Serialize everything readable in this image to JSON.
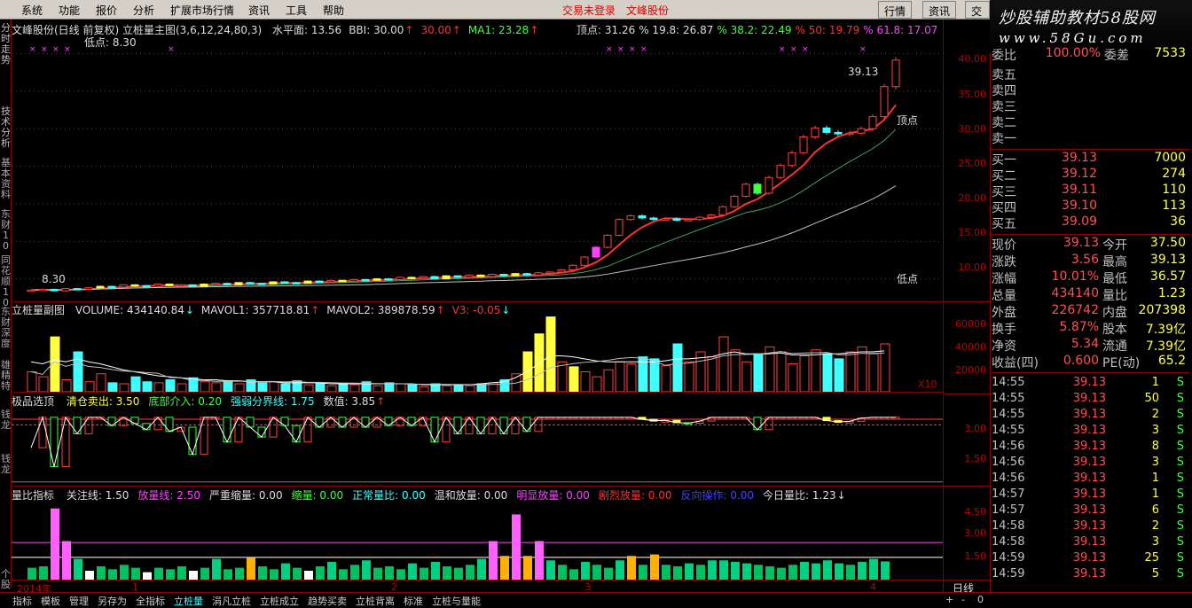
{
  "menu": [
    "系统",
    "功能",
    "报价",
    "分析",
    "扩展市场行情",
    "资讯",
    "工具",
    "帮助"
  ],
  "status": {
    "login": "交易未登录",
    "stock": "文峰股份"
  },
  "toolbar": [
    "行情",
    "资讯",
    "交"
  ],
  "watermark": {
    "line1": "炒股辅助教材58股网",
    "line2": "www.58Gu.com"
  },
  "leftnav": [
    "分时走势",
    "技术分析",
    "基本资料",
    "东财10",
    "同花顺10",
    "东财深度",
    "雄精特",
    "钱龙",
    "钱龙",
    "个股"
  ],
  "main_panel": {
    "header": "文峰股份(日线 前复权) 立桩量主图(3,6,12,24,80,3)",
    "items": [
      [
        "水平面: 13.56",
        "#ddd"
      ],
      [
        "BBI: 30.00",
        "#ddd"
      ],
      [
        "↑",
        "#ff3030"
      ],
      [
        "30.00",
        "#ff3030"
      ],
      [
        "↑",
        "#ff3030"
      ],
      [
        "MA1: 23.28",
        "#40ff40"
      ],
      [
        "↑",
        "#ff3030"
      ]
    ],
    "top_items": [
      [
        "顶点: 31.26",
        "#ddd"
      ],
      [
        "% 19.8: 26.87",
        "#ddd"
      ],
      [
        "% 38.2: 22.49",
        "#40ff40"
      ],
      [
        "% 50: 19.79",
        "#ff3030"
      ],
      [
        "% 61.8: 17.07",
        "#ff40ff"
      ]
    ],
    "lowline": "低点: 8.30",
    "topline": "顶点",
    "bottomlabel": "低点",
    "marker_top": "39.13",
    "marker_low": "8.30",
    "scale": [
      "40.00",
      "35.00",
      "30.00",
      "25.00",
      "20.00",
      "15.00",
      "10.00"
    ]
  },
  "vol_panel": {
    "title": "立桩量副图",
    "items": [
      [
        "VOLUME: 434140.84",
        "#ddd"
      ],
      [
        "↓",
        "#40ffff"
      ],
      [
        "MAVOL1: 357718.81",
        "#ddd"
      ],
      [
        "↑",
        "#ff3030"
      ],
      [
        "MAVOL2: 389878.59",
        "#ddd"
      ],
      [
        "↑",
        "#ff3030"
      ],
      [
        "V3: -0.05",
        "#ff3030"
      ],
      [
        "↓",
        "#40ffff"
      ]
    ],
    "scale": [
      "60000",
      "40000",
      "20000"
    ],
    "unit": "X10"
  },
  "sel_panel": {
    "title": "极品选顶",
    "items": [
      [
        "清仓卖出: 3.50",
        "#ffff40"
      ],
      [
        "底部介入: 0.20",
        "#40ff40"
      ],
      [
        "强弱分界线: 1.75",
        "#40ffff"
      ],
      [
        "数值: 3.85",
        "#ddd"
      ],
      [
        "↑",
        "#ff3030"
      ]
    ],
    "scale": [
      "3.00",
      "1.50"
    ]
  },
  "ratio_panel": {
    "title": "量比指标",
    "items": [
      [
        "关注线: 1.50",
        "#ddd"
      ],
      [
        "放量线: 2.50",
        "#ff40ff"
      ],
      [
        "严重缩量: 0.00",
        "#ddd"
      ],
      [
        "缩量: 0.00",
        "#40ff40"
      ],
      [
        "正常量比: 0.00",
        "#40ffff"
      ],
      [
        "温和放量: 0.00",
        "#ddd"
      ],
      [
        "明显放量: 0.00",
        "#ff40ff"
      ],
      [
        "剧烈放量: 0.00",
        "#ff3030"
      ],
      [
        "反向操作: 0.00",
        "#4040ff"
      ],
      [
        "今日量比: 1.23",
        "#ddd"
      ],
      [
        "↓",
        "#ddd"
      ]
    ],
    "scale": [
      "4.50",
      "3.00",
      "1.50"
    ]
  },
  "dates": [
    "2014年",
    "1",
    "2",
    "3",
    "4"
  ],
  "period": "日线",
  "bottom_tabs": [
    "指标",
    "模板",
    "管理",
    "另存为",
    "全指标",
    "立桩量",
    "涓凡立桩",
    "立桩成立",
    "趋势买卖",
    "立桩背离",
    "标准",
    "立桩与量能"
  ],
  "bottom_nav": [
    "+",
    "-",
    "0"
  ],
  "quote": {
    "top": {
      "label": "委比",
      "value": "100.00%",
      "label2": "委差",
      "value2": "7533"
    },
    "sell": [
      [
        "卖五",
        ""
      ],
      [
        "卖四",
        ""
      ],
      [
        "卖三",
        ""
      ],
      [
        "卖二",
        ""
      ],
      [
        "卖一",
        ""
      ]
    ],
    "buy": [
      [
        "买一",
        "39.13",
        "7000"
      ],
      [
        "买二",
        "39.12",
        "274"
      ],
      [
        "买三",
        "39.11",
        "110"
      ],
      [
        "买四",
        "39.10",
        "113"
      ],
      [
        "买五",
        "39.09",
        "36"
      ]
    ],
    "stats": [
      [
        "现价",
        "39.13",
        "今开",
        "37.50"
      ],
      [
        "涨跌",
        "3.56",
        "最高",
        "39.13"
      ],
      [
        "涨幅",
        "10.01%",
        "最低",
        "36.57"
      ],
      [
        "总量",
        "434140",
        "量比",
        "1.23"
      ],
      [
        "外盘",
        "226742",
        "内盘",
        "207398"
      ],
      [
        "换手",
        "5.87%",
        "股本",
        "7.39亿"
      ],
      [
        "净资",
        "5.34",
        "流通",
        "7.39亿"
      ],
      [
        "收益(四)",
        "0.600",
        "PE(动)",
        "65.2"
      ]
    ],
    "ticks": [
      [
        "14:55",
        "39.13",
        "1",
        "S"
      ],
      [
        "14:55",
        "39.13",
        "50",
        "S"
      ],
      [
        "14:55",
        "39.13",
        "2",
        "S"
      ],
      [
        "14:55",
        "39.13",
        "3",
        "S"
      ],
      [
        "14:56",
        "39.13",
        "8",
        "S"
      ],
      [
        "14:56",
        "39.13",
        "3",
        "S"
      ],
      [
        "14:56",
        "39.13",
        "1",
        "S"
      ],
      [
        "14:57",
        "39.13",
        "1",
        "S"
      ],
      [
        "14:57",
        "39.13",
        "6",
        "S"
      ],
      [
        "14:58",
        "39.13",
        "2",
        "S"
      ],
      [
        "14:58",
        "39.13",
        "3",
        "S"
      ],
      [
        "14:59",
        "39.13",
        "25",
        "S"
      ],
      [
        "14:59",
        "39.13",
        "5",
        "S"
      ]
    ]
  },
  "chart_data": {
    "type": "candlestick",
    "close": [
      8.5,
      8.6,
      8.4,
      8.7,
      8.6,
      8.8,
      9.0,
      8.9,
      9.2,
      9.1,
      9.0,
      9.3,
      9.1,
      9.2,
      9.0,
      9.3,
      9.4,
      9.2,
      9.5,
      9.4,
      9.3,
      9.6,
      9.5,
      9.4,
      9.7,
      9.6,
      9.8,
      9.7,
      9.9,
      9.8,
      10.0,
      9.9,
      10.2,
      10.1,
      10.3,
      10.0,
      10.4,
      10.2,
      10.5,
      10.3,
      10.6,
      10.4,
      10.7,
      10.5,
      10.8,
      10.9,
      11.2,
      11.8,
      12.9,
      14.2,
      15.8,
      17.9,
      18.4,
      18.1,
      17.9,
      18.0,
      17.8,
      17.9,
      18.2,
      18.5,
      19.6,
      21.0,
      22.6,
      21.4,
      23.5,
      25.1,
      26.8,
      28.9,
      30.1,
      29.5,
      29.3,
      29.4,
      30.0,
      31.6,
      35.6,
      39.13
    ],
    "volume": [
      20,
      15,
      55,
      12,
      40,
      10,
      18,
      9,
      8,
      15,
      10,
      9,
      12,
      8,
      14,
      10,
      9,
      11,
      8,
      12,
      9,
      10,
      8,
      11,
      7,
      9,
      6,
      8,
      7,
      10,
      6,
      9,
      8,
      7,
      5,
      8,
      6,
      7,
      6,
      8,
      9,
      12,
      18,
      40,
      58,
      75,
      30,
      25,
      20,
      15,
      22,
      30,
      28,
      35,
      33,
      26,
      48,
      30,
      40,
      35,
      55,
      42,
      30,
      38,
      45,
      40,
      28,
      36,
      42,
      38,
      33,
      40,
      45,
      38,
      48
    ],
    "mavol1": [
      30,
      28,
      32,
      30,
      33,
      30,
      28,
      25,
      22,
      20,
      18,
      16,
      15,
      14,
      13,
      12,
      12,
      11,
      11,
      10,
      10,
      10,
      9,
      9,
      9,
      9,
      8,
      8,
      8,
      8,
      8,
      8,
      8,
      8,
      7,
      7,
      7,
      7,
      7,
      8,
      9,
      10,
      14,
      20,
      28,
      36,
      36,
      35,
      33,
      31,
      30,
      30,
      30,
      30,
      30,
      31,
      33,
      33,
      34,
      35,
      38,
      40,
      38,
      38,
      38,
      39,
      37,
      37,
      37,
      38,
      38,
      39,
      40,
      40,
      41
    ],
    "ratio": [
      0.8,
      0.9,
      4.8,
      2.6,
      1.4,
      0.6,
      0.9,
      0.7,
      1.0,
      0.8,
      0.5,
      0.8,
      0.7,
      0.9,
      0.6,
      0.8,
      1.4,
      0.7,
      0.8,
      1.5,
      0.9,
      0.7,
      1.1,
      0.8,
      0.6,
      0.9,
      1.2,
      0.7,
      1.0,
      1.3,
      0.8,
      0.9,
      0.7,
      1.1,
      0.8,
      1.2,
      0.9,
      0.8,
      1.0,
      1.4,
      2.6,
      1.6,
      4.4,
      1.6,
      2.6,
      1.3,
      1.0,
      0.7,
      1.2,
      1.0,
      0.8,
      1.3,
      1.6,
      1.0,
      1.7,
      1.0,
      0.9,
      1.1,
      1.0,
      1.3,
      1.3,
      1.2,
      1.1,
      1.0,
      0.9,
      0.8,
      1.0,
      1.2,
      1.1,
      1.3,
      1.1,
      1.0,
      1.2,
      1.4,
      1.23
    ]
  }
}
